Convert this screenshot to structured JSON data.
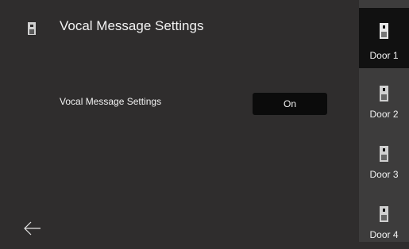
{
  "header": {
    "title": "Vocal Message Settings",
    "icon": "door-panel-icon"
  },
  "settings": {
    "row_label": "Vocal Message Settings",
    "toggle_value": "On"
  },
  "footer": {
    "back_icon": "back-arrow-icon"
  },
  "sidebar": {
    "active_index": 0,
    "items": [
      {
        "label": "Door 1",
        "icon": "door-panel-icon"
      },
      {
        "label": "Door 2",
        "icon": "door-panel-icon"
      },
      {
        "label": "Door 3",
        "icon": "door-panel-icon"
      },
      {
        "label": "Door 4",
        "icon": "door-panel-icon"
      }
    ]
  },
  "colors": {
    "background": "#2f2d2d",
    "sidebar": "#3d3c3c",
    "active": "#111111",
    "toggle": "#0b0b0b",
    "text": "#f2f2f2"
  }
}
